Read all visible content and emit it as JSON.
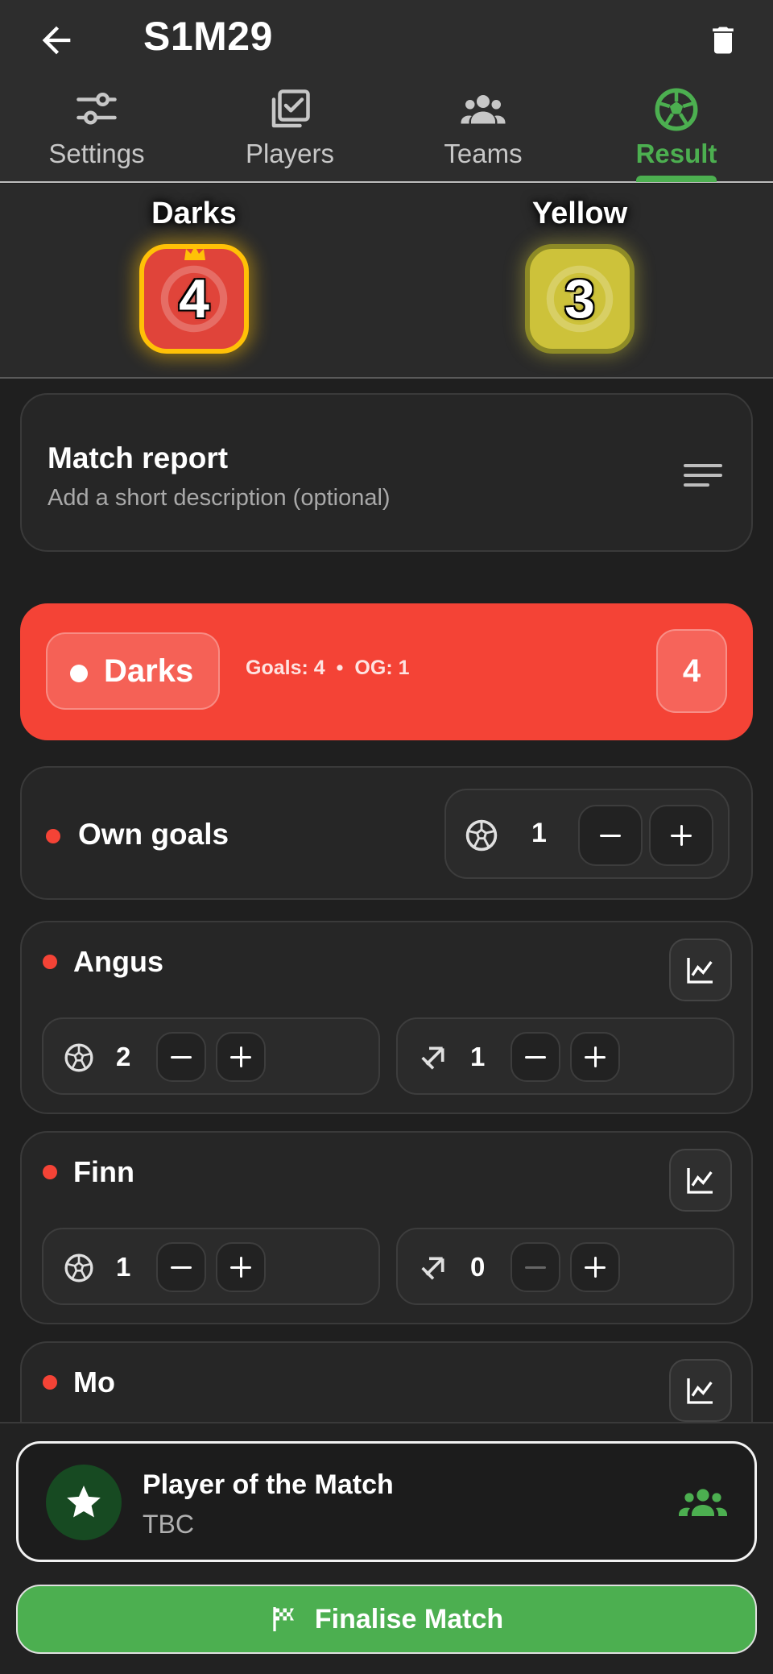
{
  "header": {
    "title": "S1M29",
    "back_icon": "arrow-back-icon",
    "delete_icon": "trash-icon"
  },
  "tabs": [
    {
      "label": "Settings",
      "icon": "sliders-icon",
      "active": false
    },
    {
      "label": "Players",
      "icon": "checklist-icon",
      "active": false
    },
    {
      "label": "Teams",
      "icon": "group-icon",
      "active": false
    },
    {
      "label": "Result",
      "icon": "soccer-ball-icon",
      "active": true
    }
  ],
  "colors": {
    "accent": "#4caf50",
    "team_dark": "#f44336",
    "team_yellow": "#cdc23a",
    "winner_border": "#ffc107"
  },
  "scoreboard": {
    "home": {
      "name": "Darks",
      "score": "4",
      "winner": true
    },
    "away": {
      "name": "Yellow",
      "score": "3",
      "winner": false
    }
  },
  "report": {
    "title": "Match report",
    "placeholder": "Add a short description (optional)"
  },
  "team_section": {
    "name": "Darks",
    "goals_text": "Goals: 4",
    "separator": "•",
    "og_text": "OG: 1",
    "total": "4"
  },
  "own_goals": {
    "label": "Own goals",
    "count": "1"
  },
  "players": [
    {
      "name": "Angus",
      "goals": "2",
      "assists": "1",
      "assists_minus_disabled": false
    },
    {
      "name": "Finn",
      "goals": "1",
      "assists": "0",
      "assists_minus_disabled": true
    },
    {
      "name": "Mo",
      "goals": "",
      "assists": "",
      "assists_minus_disabled": false
    }
  ],
  "potm": {
    "title": "Player of the Match",
    "value": "TBC"
  },
  "finalise": {
    "label": "Finalise Match"
  }
}
